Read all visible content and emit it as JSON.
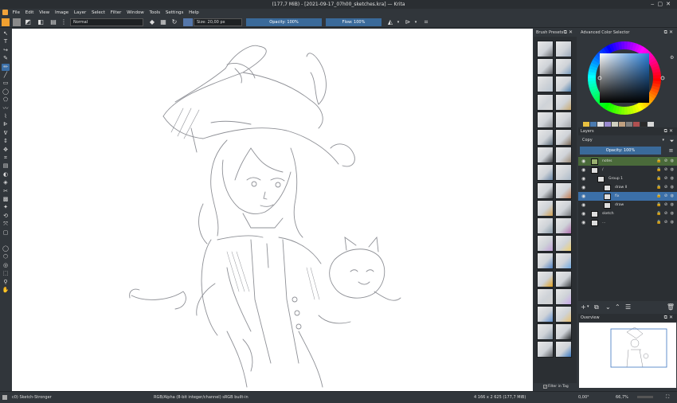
{
  "window": {
    "title": "(177,7 MiB) - [2021-09-17_07h00_sketches.kra] — Krita"
  },
  "menu": [
    "File",
    "Edit",
    "View",
    "Image",
    "Layer",
    "Select",
    "Filter",
    "Window",
    "Tools",
    "Settings",
    "Help"
  ],
  "toolbar": {
    "blend_mode": "Normal",
    "size": "Size: 20,00 px",
    "opacity": "Opacity: 100%",
    "flow": "Flow: 100%",
    "fg_color": "#f0a030",
    "bg_color": "#8a8a8a"
  },
  "brush_presets": {
    "title": "Brush Presets",
    "filter_label": "Filter in Tag"
  },
  "color_selector": {
    "title": "Advanced Color Selector",
    "history": [
      "#e8c040",
      "#4a7ab0",
      "#e0e0e0",
      "#9a8ad0",
      "#d0d0c0",
      "#c0a080",
      "#808080",
      "#b05050",
      "#2a2a2a",
      "#d8d8d8"
    ]
  },
  "layers": {
    "title": "Layers",
    "blend": "Copy",
    "opacity": "Opacity: 100%",
    "items": [
      {
        "name": "notes",
        "highlight": "notes"
      },
      {
        "name": "/",
        "highlight": "none"
      },
      {
        "name": "Group 1",
        "highlight": "none"
      },
      {
        "name": "draw II",
        "highlight": "none"
      },
      {
        "name": "fix",
        "highlight": "selected"
      },
      {
        "name": "draw",
        "highlight": "none"
      },
      {
        "name": "sketch",
        "highlight": "none"
      },
      {
        "name": "...",
        "highlight": "none"
      }
    ]
  },
  "overview": {
    "title": "Overview"
  },
  "status": {
    "brush": "c0) Sketch-Stronger",
    "color_model": "RGB/Alpha (8-bit integer/channel)  sRGB built-in",
    "dimensions": "4 166 x 2 625 (177,7 MiB)",
    "rotation": "0,00°",
    "zoom": "66,7%"
  }
}
